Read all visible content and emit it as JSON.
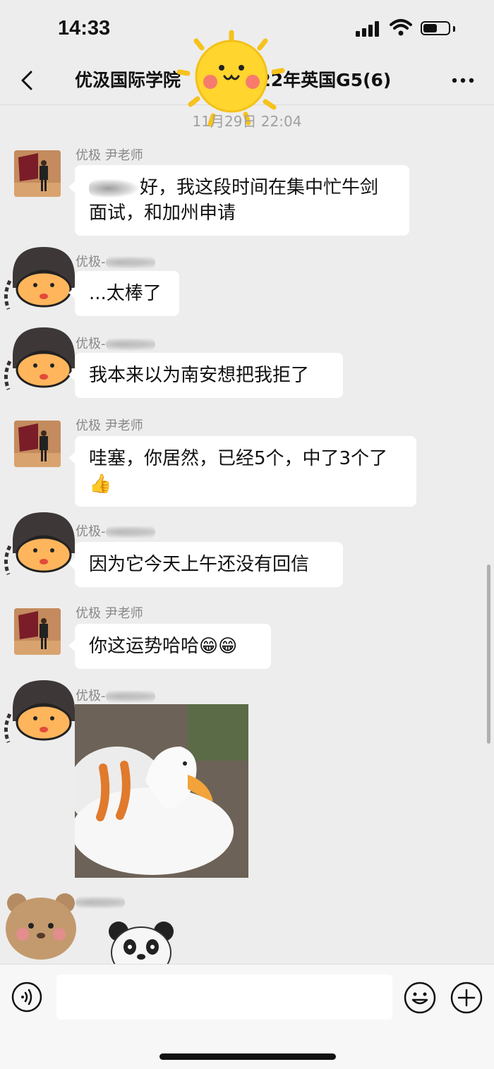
{
  "status_bar": {
    "time": "14:33",
    "battery_level": 0.55
  },
  "nav": {
    "title_left": "优汲国际学院",
    "title_right": "-22年英国G5(6)",
    "back_icon": "chevron-left-icon",
    "more_icon": "more-dots-icon"
  },
  "timestamp": "11月29日 22:04",
  "messages": [
    {
      "sender": "优极 尹老师",
      "text": "好，我这段时间在集中忙牛剑面试，和加州申请"
    },
    {
      "sender": "优极-",
      "text": "...太棒了"
    },
    {
      "sender": "优极-",
      "text": "我本来以为南安想把我拒了"
    },
    {
      "sender": "优极 尹老师",
      "text": "哇塞，你居然，已经5个，中了3个了",
      "emoji": "👍"
    },
    {
      "sender": "优极-",
      "text": "因为它今天上午还没有回信"
    },
    {
      "sender": "优极 尹老师",
      "text": "你这运势哈哈",
      "emoji": "😁😁"
    },
    {
      "sender": "优极-"
    }
  ],
  "input": {
    "placeholder": "",
    "voice_icon": "voice-icon",
    "emoji_icon": "smile-icon",
    "plus_icon": "plus-icon"
  }
}
